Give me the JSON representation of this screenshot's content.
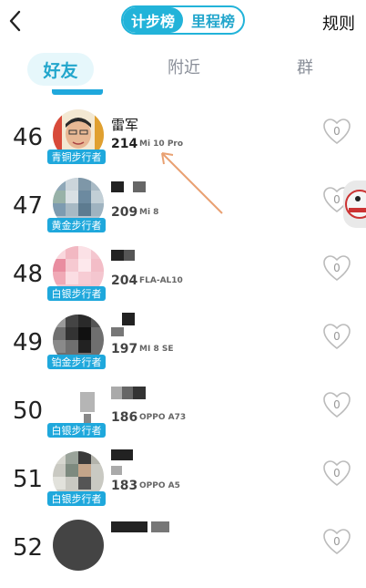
{
  "header": {
    "segment": {
      "active": "计步榜",
      "inactive": "里程榜"
    },
    "rules_label": "规则"
  },
  "tabs": [
    "好友",
    "附近",
    "群"
  ],
  "rows": [
    {
      "rank": "46",
      "name": "雷军",
      "steps": "214",
      "device": "Mi 10 Pro",
      "badge": "青铜步行者",
      "likes": "0"
    },
    {
      "rank": "47",
      "name": "",
      "steps": "209",
      "device": "Mi 8",
      "badge": "黄金步行者",
      "likes": "0"
    },
    {
      "rank": "48",
      "name": "",
      "steps": "204",
      "device": "FLA-AL10",
      "badge": "白银步行者",
      "likes": "0"
    },
    {
      "rank": "49",
      "name": "",
      "steps": "197",
      "device": "MI 8 SE",
      "badge": "铂金步行者",
      "likes": "0"
    },
    {
      "rank": "50",
      "name": "",
      "steps": "186",
      "device": "OPPO A73",
      "badge": "白银步行者",
      "likes": "0"
    },
    {
      "rank": "51",
      "name": "",
      "steps": "183",
      "device": "OPPO A5",
      "badge": "白银步行者",
      "likes": "0"
    },
    {
      "rank": "52",
      "name": "",
      "steps": "",
      "device": "",
      "badge": "",
      "likes": "0"
    }
  ],
  "colors": {
    "accent": "#22b3d9",
    "badge": "#1fa8dc",
    "tab_bg": "#e6f7fb"
  }
}
